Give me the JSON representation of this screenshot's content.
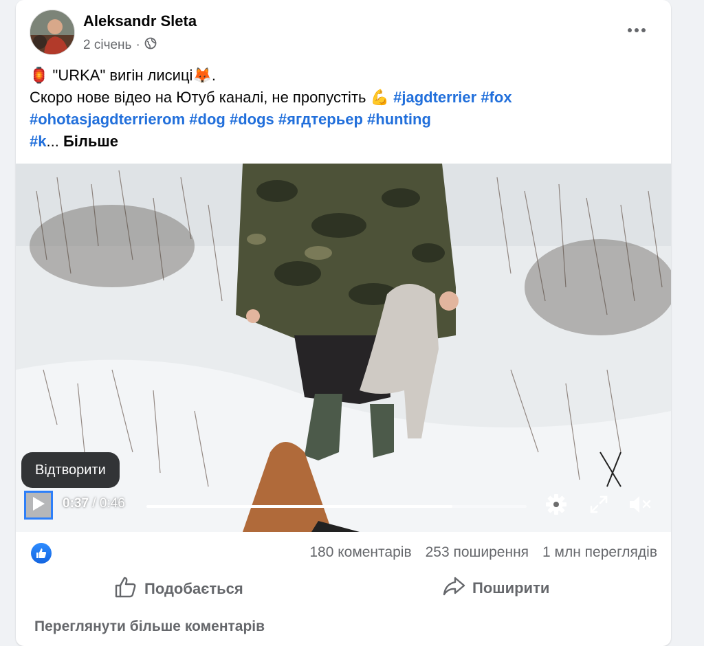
{
  "post": {
    "author": "Aleksandr Sleta",
    "date": "2 січень",
    "separator": "·",
    "privacy_icon": "globe-icon",
    "more_icon": "more-horizontal-icon",
    "text": {
      "line1_emoji": "🏮",
      "line1_text": " \"URKA\" вигін лисиці",
      "line1_emoji2": "🦊",
      "line1_end": ".",
      "line2_text": "Скоро нове відео на Ютуб каналі, не пропустіть ",
      "line2_emoji": "💪",
      "hashtags_line2": [
        "#jagdterrier",
        "#fox"
      ],
      "hashtags_line3": [
        "#ohotasjagdterrierom",
        "#dog",
        "#dogs",
        "#ягдтерьер",
        "#hunting"
      ],
      "truncated_tag": "#k",
      "ellipsis": "...",
      "see_more": "Більше"
    }
  },
  "video": {
    "tooltip": "Відтворити",
    "current_time": "0:37",
    "duration_sep": " / ",
    "duration": "0:46",
    "progress_fraction": 0.804,
    "icons": [
      "play-icon",
      "settings-icon",
      "fullscreen-icon",
      "muted-icon"
    ]
  },
  "stats": {
    "reaction_icon": "like-reaction-icon",
    "comments": "180 коментарів",
    "shares": "253 поширення",
    "views": "1 млн переглядів"
  },
  "actions": {
    "like_label": "Подобається",
    "share_label": "Поширити"
  },
  "footer": {
    "more_comments": "Переглянути більше коментарів"
  },
  "colors": {
    "hashtag": "#216fdb",
    "secondary_text": "#65676b",
    "focus_ring": "#2d7ff9"
  }
}
